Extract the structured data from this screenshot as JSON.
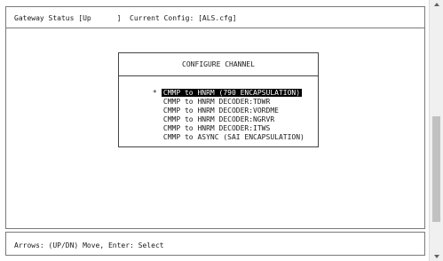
{
  "status_bar": {
    "text": "Gateway Status [Up      ]  Current Config: [ALS.cfg]"
  },
  "menu": {
    "title": "CONFIGURE CHANNEL",
    "selected_marker": "*",
    "items": [
      {
        "label": "CMMP to HNRM (790 ENCAPSULATION)",
        "selected": true
      },
      {
        "label": "CMMP to HNRM DECODER:TDWR",
        "selected": false
      },
      {
        "label": "CMMP to HNRM DECODER:VORDME",
        "selected": false
      },
      {
        "label": "CMMP to HNRM DECODER:NGRVR",
        "selected": false
      },
      {
        "label": "CMMP to HNRM DECODER:ITWS",
        "selected": false
      },
      {
        "label": "CMMP to ASYNC (SAI ENCAPSULATION)",
        "selected": false
      }
    ]
  },
  "footer": {
    "text": "Arrows: (UP/DN) Move, Enter: Select"
  },
  "colors": {
    "highlight_bg": "#000000",
    "highlight_fg": "#ffffff"
  }
}
